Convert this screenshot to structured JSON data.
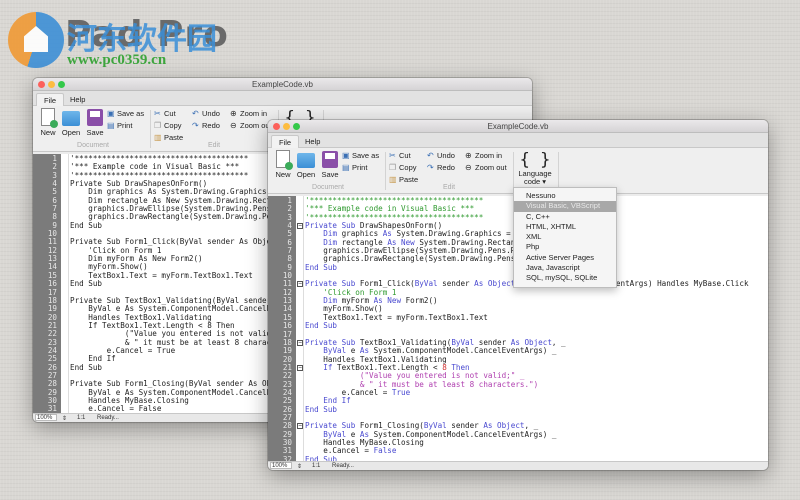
{
  "watermark": {
    "logo_text": "Pad Pro",
    "site_name": "河东软件园",
    "url": "www.pc0359.cn"
  },
  "window": {
    "title": "ExampleCode.vb",
    "tabs": [
      "File",
      "Help"
    ],
    "selected_tab": "File",
    "ribbon": {
      "new": "New",
      "open": "Open",
      "save": "Save",
      "save_as": "Save as",
      "print": "Print",
      "cut": "Cut",
      "copy": "Copy",
      "paste": "Paste",
      "undo": "Undo",
      "redo": "Redo",
      "zoom_in": "Zoom in",
      "zoom_out": "Zoom out",
      "language_line1": "Language",
      "language_line2": "code ▾",
      "group_document": "Document",
      "group_edit": "Edit"
    },
    "status": {
      "zoom": "100%",
      "position": "1:1",
      "message": "Ready..."
    }
  },
  "language_menu": {
    "items": [
      "Nessuno",
      "Visual Basic, VBScript",
      "C, C++",
      "HTML, XHTML",
      "XML",
      "Php",
      "Active Server Pages",
      "Java, Javascript",
      "SQL, mySQL, SQLite"
    ],
    "selected": "Visual Basic, VBScript"
  },
  "colors": {
    "keyword": "#4a4ad0",
    "comment": "#2f9a2f",
    "string": "#b040b0",
    "number": "#d03030"
  },
  "code_lines": [
    [
      [
        "c",
        "'**************************************"
      ]
    ],
    [
      [
        "c",
        "'*** Example code in Visual Basic ***"
      ]
    ],
    [
      [
        "c",
        "'**************************************"
      ]
    ],
    [
      [
        "k",
        "Private Sub"
      ],
      [
        "p",
        " DrawShapesOnForm()"
      ]
    ],
    [
      [
        "p",
        "    "
      ],
      [
        "k",
        "Dim"
      ],
      [
        "p",
        " graphics "
      ],
      [
        "k",
        "As"
      ],
      [
        "p",
        " System.Drawing.Graphics = Me.CreateGraphics()"
      ]
    ],
    [
      [
        "p",
        "    "
      ],
      [
        "k",
        "Dim"
      ],
      [
        "p",
        " rectangle "
      ],
      [
        "k",
        "As New"
      ],
      [
        "p",
        " System.Drawing.Rectangle("
      ],
      [
        "n",
        "50"
      ],
      [
        "p",
        ", "
      ],
      [
        "n",
        "50"
      ],
      [
        "p",
        ", "
      ],
      [
        "n",
        "150"
      ],
      [
        "p",
        ", "
      ],
      [
        "n",
        "100"
      ],
      [
        "p",
        ")"
      ]
    ],
    [
      [
        "p",
        "    graphics.DrawEllipse(System.Drawing.Pens.Red, rectangle)"
      ]
    ],
    [
      [
        "p",
        "    graphics.DrawRectangle(System.Drawing.Pens.Blue, rectangle)"
      ]
    ],
    [
      [
        "k",
        "End Sub"
      ]
    ],
    [],
    [
      [
        "k",
        "Private Sub"
      ],
      [
        "p",
        " Form1_Click("
      ],
      [
        "k",
        "ByVal"
      ],
      [
        "p",
        " sender "
      ],
      [
        "k",
        "As Object"
      ],
      [
        "p",
        ", "
      ],
      [
        "k",
        "ByVal"
      ],
      [
        "p",
        " e "
      ],
      [
        "k",
        "As"
      ],
      [
        "p",
        " System.EventArgs) Handles MyBase.Click"
      ]
    ],
    [
      [
        "p",
        "    "
      ],
      [
        "c",
        "'Click on Form 1"
      ]
    ],
    [
      [
        "p",
        "    "
      ],
      [
        "k",
        "Dim"
      ],
      [
        "p",
        " myForm "
      ],
      [
        "k",
        "As New"
      ],
      [
        "p",
        " Form2()"
      ]
    ],
    [
      [
        "p",
        "    myForm.Show()"
      ]
    ],
    [
      [
        "p",
        "    TextBox1.Text = myForm.TextBox1.Text"
      ]
    ],
    [
      [
        "k",
        "End Sub"
      ]
    ],
    [],
    [
      [
        "k",
        "Private Sub"
      ],
      [
        "p",
        " TextBox1_Validating("
      ],
      [
        "k",
        "ByVal"
      ],
      [
        "p",
        " sender "
      ],
      [
        "k",
        "As Object"
      ],
      [
        "p",
        ", _"
      ]
    ],
    [
      [
        "p",
        "    "
      ],
      [
        "k",
        "ByVal"
      ],
      [
        "p",
        " e "
      ],
      [
        "k",
        "As"
      ],
      [
        "p",
        " System.ComponentModel.CancelEventArgs) _"
      ]
    ],
    [
      [
        "p",
        "    Handles TextBox1.Validating"
      ]
    ],
    [
      [
        "p",
        "    "
      ],
      [
        "k",
        "If"
      ],
      [
        "p",
        " TextBox1.Text.Length < "
      ],
      [
        "n",
        "8"
      ],
      [
        "p",
        " "
      ],
      [
        "k",
        "Then"
      ]
    ],
    [
      [
        "p",
        "            "
      ],
      [
        "s",
        "(\"Value you entered is not valid;\" _"
      ]
    ],
    [
      [
        "p",
        "            "
      ],
      [
        "s",
        "& \" it must be at least 8 characters.\")"
      ]
    ],
    [
      [
        "p",
        "        e.Cancel = "
      ],
      [
        "k",
        "True"
      ]
    ],
    [
      [
        "p",
        "    "
      ],
      [
        "k",
        "End If"
      ]
    ],
    [
      [
        "k",
        "End Sub"
      ]
    ],
    [],
    [
      [
        "k",
        "Private Sub"
      ],
      [
        "p",
        " Form1_Closing("
      ],
      [
        "k",
        "ByVal"
      ],
      [
        "p",
        " sender "
      ],
      [
        "k",
        "As Object"
      ],
      [
        "p",
        ", _"
      ]
    ],
    [
      [
        "p",
        "    "
      ],
      [
        "k",
        "ByVal"
      ],
      [
        "p",
        " e "
      ],
      [
        "k",
        "As"
      ],
      [
        "p",
        " System.ComponentModel.CancelEventArgs) _"
      ]
    ],
    [
      [
        "p",
        "    Handles MyBase.Closing"
      ]
    ],
    [
      [
        "p",
        "    e.Cancel = "
      ],
      [
        "k",
        "False"
      ]
    ],
    [
      [
        "k",
        "End Sub"
      ]
    ]
  ],
  "fold_markers": [
    4,
    11,
    18,
    21,
    28
  ]
}
